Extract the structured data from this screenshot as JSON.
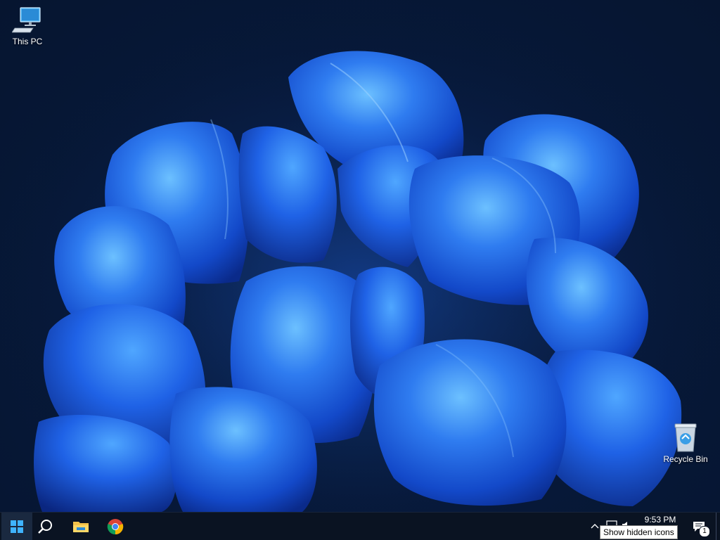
{
  "desktop": {
    "wallpaper_icon": "bloom-wallpaper",
    "icons": [
      {
        "label": "This PC",
        "icon": "computer-monitor-icon"
      },
      {
        "label": "Recycle Bin",
        "icon": "recycle-bin-icon"
      }
    ]
  },
  "taskbar": {
    "start_icon": "windows-logo-icon",
    "search_icon": "search-icon",
    "pinned": [
      {
        "app": "File Explorer",
        "icon": "folder-icon"
      },
      {
        "app": "Google Chrome",
        "icon": "chrome-icon"
      }
    ],
    "tray": {
      "chevron_icon": "chevron-up-icon",
      "network_icon": "network-icon",
      "volume_icon": "speaker-icon",
      "time": "9:53 PM",
      "notification_icon": "action-center-icon",
      "notification_count": "1"
    },
    "tooltip": "Show hidden icons"
  },
  "colors": {
    "taskbar_bg": "#0a1322",
    "desktop_bg": "#061530",
    "bloom_blue": "#1a5fe0",
    "bloom_light": "#5ab0ff"
  }
}
